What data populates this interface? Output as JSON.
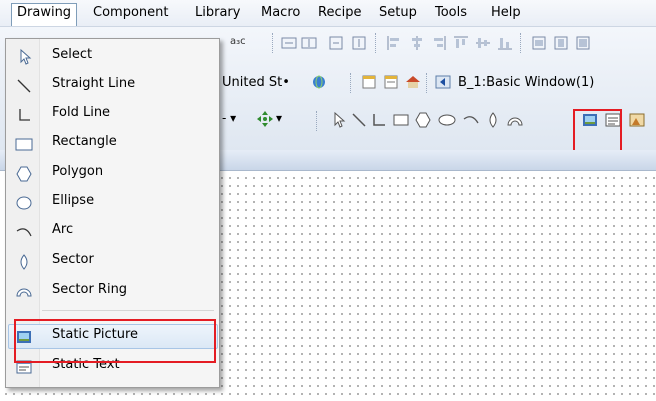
{
  "menubar": {
    "items": [
      "Drawing",
      "Component",
      "Library",
      "Macro",
      "Recipe",
      "Setup",
      "Tools",
      "Help"
    ],
    "active": "Drawing"
  },
  "toolbar": {
    "language_select": "United St•",
    "window_select": "B_1:Basic Window(1)",
    "icon_small_label": "a₃c"
  },
  "drawing_menu": {
    "items": [
      {
        "label": "Select",
        "icon": "arrow-cursor-icon"
      },
      {
        "label": "Straight Line",
        "icon": "straight-line-icon"
      },
      {
        "label": "Fold Line",
        "icon": "fold-line-icon"
      },
      {
        "label": "Rectangle",
        "icon": "rectangle-icon"
      },
      {
        "label": "Polygon",
        "icon": "polygon-icon"
      },
      {
        "label": "Ellipse",
        "icon": "ellipse-icon"
      },
      {
        "label": "Arc",
        "icon": "arc-icon"
      },
      {
        "label": "Sector",
        "icon": "sector-icon"
      },
      {
        "label": "Sector Ring",
        "icon": "sector-ring-icon"
      },
      {
        "label": "Static Picture",
        "icon": "static-picture-icon"
      },
      {
        "label": "Static Text",
        "icon": "static-text-icon"
      }
    ],
    "highlighted": "Static Picture"
  },
  "colors": {
    "highlight_box": "#e41c23",
    "menu_border": "#7f9db9",
    "canvas_dots": "#9a9a9a"
  }
}
